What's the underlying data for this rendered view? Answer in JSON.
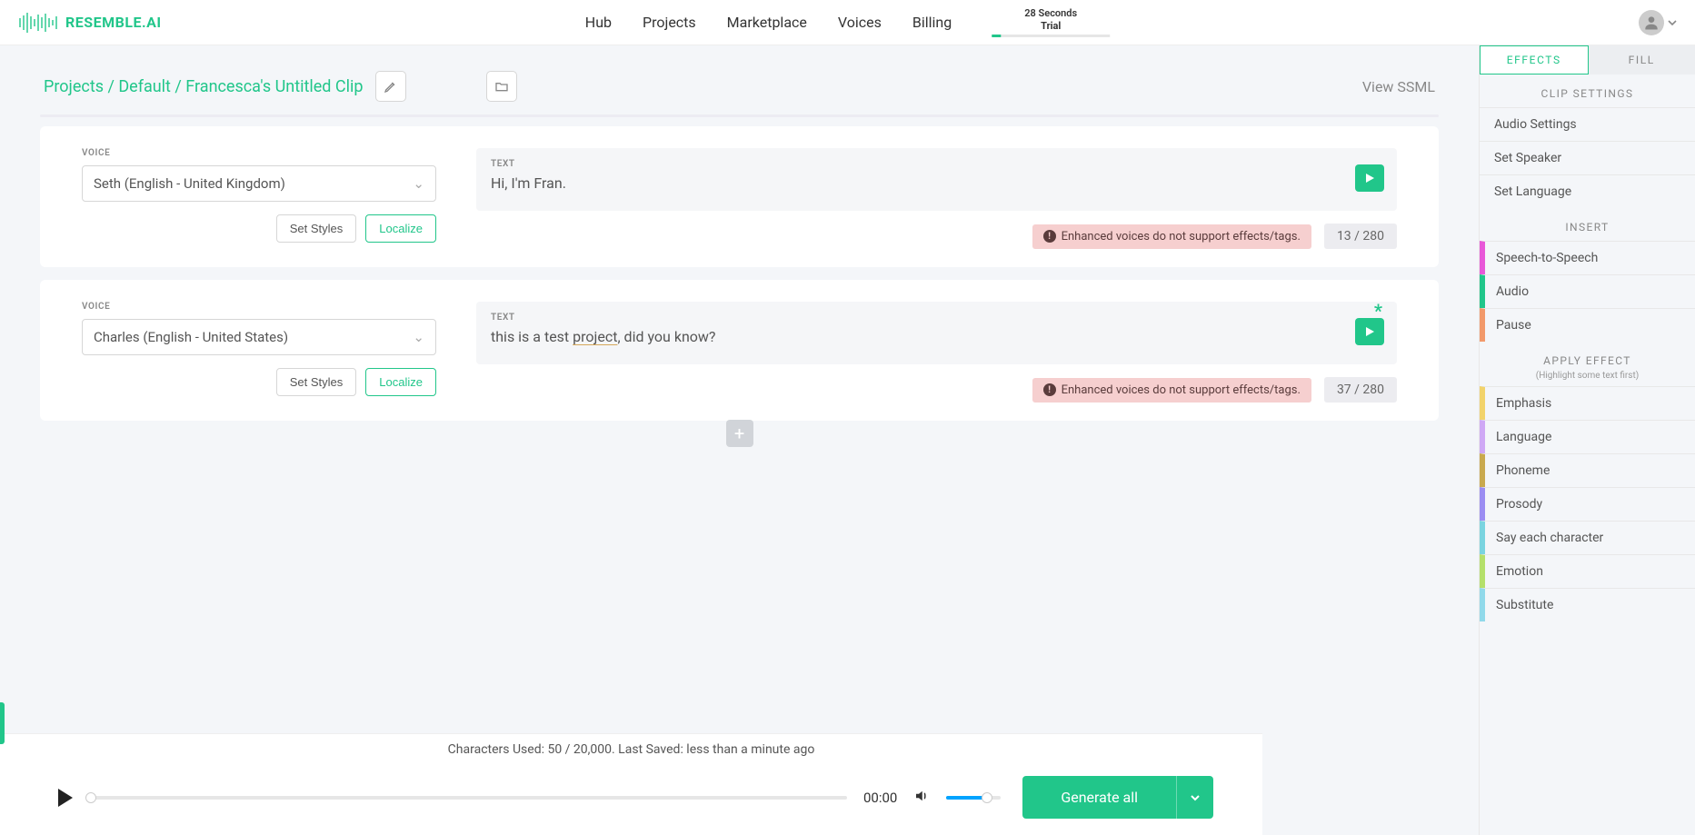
{
  "brand": "RESEMBLE.AI",
  "nav": {
    "items": [
      "Hub",
      "Projects",
      "Marketplace",
      "Voices",
      "Billing"
    ],
    "trial_top": "28 Seconds",
    "trial_bot": "Trial"
  },
  "breadcrumb": {
    "text": "Projects / Default / Francesca's Untitled Clip",
    "view_ssml": "View SSML"
  },
  "clips": [
    {
      "voice_label": "VOICE",
      "voice": "Seth (English - United Kingdom)",
      "set_styles": "Set Styles",
      "localize": "Localize",
      "text_label": "TEXT",
      "text": "Hi, I'm Fran.",
      "warning": "Enhanced voices do not support effects/tags.",
      "count": "13 / 280",
      "has_star": false
    },
    {
      "voice_label": "VOICE",
      "voice": "Charles (English - United States)",
      "set_styles": "Set Styles",
      "localize": "Localize",
      "text_label": "TEXT",
      "text_pre": "this is a test ",
      "text_under": "project",
      "text_post": ", did you know?",
      "warning": "Enhanced voices do not support effects/tags.",
      "count": "37 / 280",
      "has_star": true
    }
  ],
  "footer": {
    "status": "Characters Used: 50 / 20,000. Last Saved: less than a minute ago",
    "time": "00:00",
    "generate": "Generate all"
  },
  "sidebar": {
    "tabs": {
      "effects": "EFFECTS",
      "fill": "FILL"
    },
    "sections": {
      "clip_settings": {
        "title": "CLIP SETTINGS",
        "items": [
          "Audio Settings",
          "Set Speaker",
          "Set Language"
        ]
      },
      "insert": {
        "title": "INSERT",
        "items": [
          "Speech-to-Speech",
          "Audio",
          "Pause"
        ]
      },
      "apply": {
        "title": "APPLY EFFECT",
        "sub": "(Highlight some text first)",
        "items": [
          "Emphasis",
          "Language",
          "Phoneme",
          "Prosody",
          "Say each character",
          "Emotion",
          "Substitute"
        ]
      }
    }
  }
}
